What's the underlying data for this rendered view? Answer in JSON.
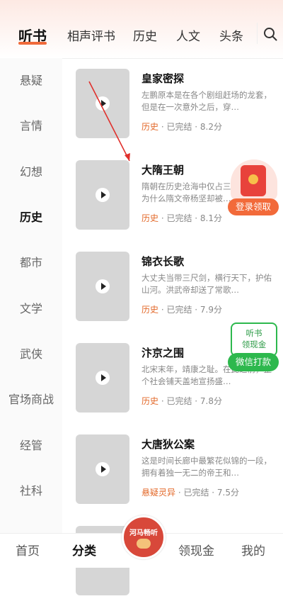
{
  "top_tabs": [
    "听书",
    "相声评书",
    "历史",
    "人文",
    "头条"
  ],
  "sidebar": [
    "悬疑",
    "言情",
    "幻想",
    "历史",
    "都市",
    "文学",
    "武侠",
    "官场商战",
    "经管",
    "社科"
  ],
  "books": [
    {
      "title": "皇家密探",
      "desc": "左鹏原本是在各个剧组赶场的龙套，但是在一次意外之后，穿…",
      "genre": "历史",
      "status": "· 已完结 · 8.2分"
    },
    {
      "title": "大隋王朝",
      "desc": "隋朝在历史沧海中仅占三十七年，是为什么隋文帝杨坚却被…",
      "genre": "历史",
      "status": "· 已完结 · 8.1分"
    },
    {
      "title": "锦衣长歌",
      "desc": "大丈夫当带三尺剑，横行天下，护佑山河。洪武帝却送了常歌…",
      "genre": "历史",
      "status": "· 已完结 · 7.9分"
    },
    {
      "title": "汴京之围",
      "desc": "北宋末年，靖康之耻。在此之前，整个社会铺天盖地宣扬盛…",
      "genre": "历史",
      "status": "· 已完结 · 7.8分"
    },
    {
      "title": "大唐狄公案",
      "desc": "这是时间长廊中最繁花似锦的一段，拥有着独一无二的帝王和…",
      "genre": "悬疑灵异",
      "status": "· 已完结 · 7.5分"
    }
  ],
  "widgets": {
    "login_reward": "登录领取",
    "cash_line1": "听书",
    "cash_line2": "领现金",
    "wechat_withdraw": "微信打款"
  },
  "bottom_nav": {
    "home": "首页",
    "category": "分类",
    "center_brand": "河马畅听",
    "cash": "领现金",
    "mine": "我的"
  },
  "colors": {
    "accent": "#f06a3a",
    "genre": "#e3692a",
    "green": "#2db84d",
    "red": "#e8423b"
  }
}
